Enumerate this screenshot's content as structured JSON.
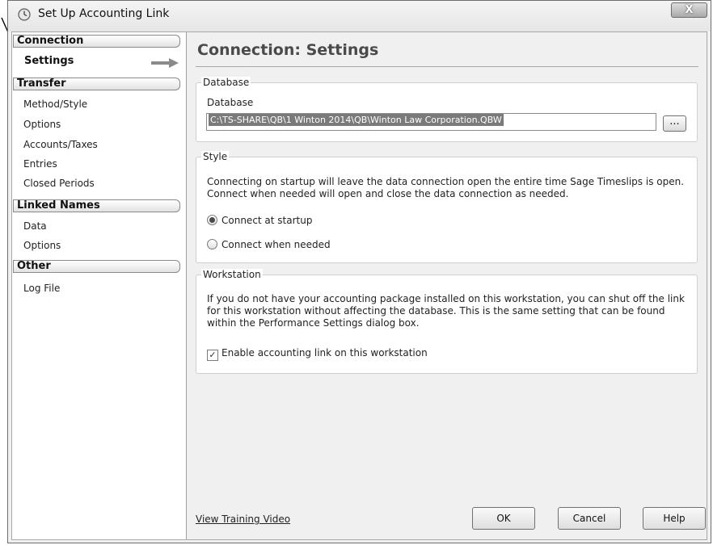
{
  "window": {
    "title": "Set Up Accounting Link",
    "close_label": "X"
  },
  "sidebar": {
    "sections": [
      {
        "label": "Connection",
        "items": [
          {
            "label": "Settings",
            "active": true
          }
        ]
      },
      {
        "label": "Transfer",
        "items": [
          {
            "label": "Method/Style"
          },
          {
            "label": "Options"
          },
          {
            "label": "Accounts/Taxes"
          },
          {
            "label": "Entries"
          },
          {
            "label": "Closed Periods"
          }
        ]
      },
      {
        "label": "Linked Names",
        "items": [
          {
            "label": "Data"
          },
          {
            "label": "Options"
          }
        ]
      },
      {
        "label": "Other",
        "items": [
          {
            "label": "Log File"
          }
        ]
      }
    ]
  },
  "main": {
    "title": "Connection: Settings",
    "database": {
      "legend": "Database",
      "field_label": "Database",
      "path_value": "C:\\TS-SHARE\\QB\\1 Winton 2014\\QB\\Winton Law Corporation.QBW",
      "browse_label": "..."
    },
    "style": {
      "legend": "Style",
      "description": "Connecting on startup will leave the data connection open the entire time Sage Timeslips is open. Connect when needed will open and close the data connection as needed.",
      "options": [
        {
          "label": "Connect at startup",
          "selected": true
        },
        {
          "label": "Connect when needed",
          "selected": false
        }
      ]
    },
    "workstation": {
      "legend": "Workstation",
      "description": "If you do not have your accounting package installed on this workstation, you can shut off the link for this workstation without affecting the database. This is the same setting that can be found within the Performance Settings dialog box.",
      "checkbox_label": "Enable accounting link on this workstation",
      "checked": true
    }
  },
  "footer": {
    "training_link": "View Training Video",
    "ok_label": "OK",
    "cancel_label": "Cancel",
    "help_label": "Help"
  },
  "icons": {
    "title": "clock-icon",
    "browse": "ellipsis-icon",
    "nav_arrow": "right-arrow-icon",
    "annotation": "callout-arrow-icon"
  },
  "colors": {
    "selection_highlight": "#7a7a7a",
    "title_color": "#4a4a4a",
    "content_background": "#f0f0f0"
  }
}
